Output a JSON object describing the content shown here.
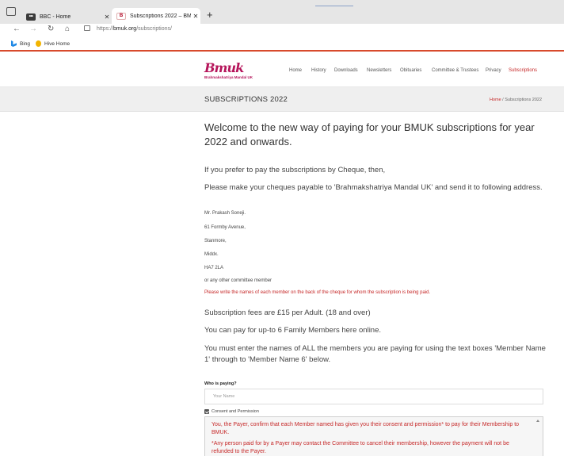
{
  "browser": {
    "tabs": [
      {
        "label": "BBC - Home",
        "favicon": "bbc-icon"
      },
      {
        "label": "Subscriptions 2022 – BMUK",
        "favicon": "bmuk-icon"
      }
    ],
    "url_prefix": "https://",
    "url_domain": "bmuk.org",
    "url_path": "/subscriptions/",
    "favorites": [
      {
        "label": "Bing",
        "icon": "bing-icon"
      },
      {
        "label": "Hive Home",
        "icon": "hive-icon"
      }
    ]
  },
  "site": {
    "logo_mark": "Bmuk",
    "logo_sub": "Brahmakshatriya Mandal UK",
    "menu": [
      "Home",
      "History",
      "Downloads",
      "Newsletters",
      "Obituaries",
      "Committee & Trustees",
      "Privacy",
      "Subscriptions"
    ],
    "active_menu": "Subscriptions"
  },
  "titlebar": {
    "title": "SUBSCRIPTIONS 2022",
    "crumb_home": "Home",
    "crumb_sep": " / ",
    "crumb_current": "Subscriptions 2022"
  },
  "content": {
    "welcome": "Welcome to the new way of paying for your BMUK subscriptions for year 2022 and onwards.",
    "cheque_intro": "If you prefer to pay the subscriptions by Cheque, then,",
    "cheque_payable": "Please make your cheques payable to 'Brahmakshatriya Mandal UK' and send it to following address.",
    "address": [
      "Mr. Prakash Soneji.",
      "61 Formby Avenue,",
      "Stanmore,",
      "Middx.",
      "HA7 2LA"
    ],
    "other_member": "or any other committee member",
    "names_note": "Please write the names of each member on the back of the cheque for whom the subscription is being paid.",
    "fees": "Subscription fees are £15 per Adult. (18 and over)",
    "family": "You can pay for up-to 6 Family Members here online.",
    "names_instruction": "You must enter the names of ALL the members you are paying for using the text boxes 'Member Name 1' through to 'Member Name 6' below."
  },
  "form": {
    "who_label": "Who is paying?",
    "who_placeholder": "Your Name",
    "consent_label": "Consent and Permission",
    "consent_text_1": "You, the Payer, confirm that each Member named has given you their consent and permission* to pay for their Membership to BMUK.",
    "consent_text_2": "*Any person paid for by a Payer may contact the Committee to cancel their membership, however the payment will not be refunded to the Payer."
  }
}
